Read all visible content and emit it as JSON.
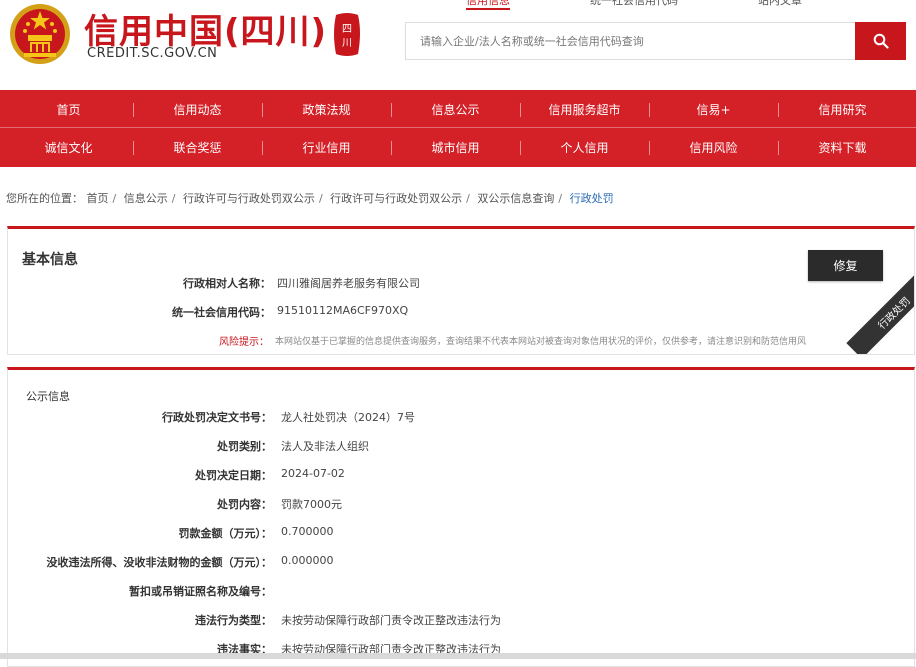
{
  "header": {
    "site_name": "信用中国(四川)",
    "site_url": "CREDIT.SC.GOV.CN",
    "seal_text": "四川",
    "top_links": [
      "信用信息",
      "统一社会信用代码",
      "站内文章"
    ],
    "search_placeholder": "请输入企业/法人名称或统一社会信用代码查询",
    "brand_color": "#c8161d"
  },
  "nav": {
    "row1": [
      "首页",
      "信用动态",
      "政策法规",
      "信息公示",
      "信用服务超市",
      "信易+",
      "信用研究"
    ],
    "row2": [
      "诚信文化",
      "联合奖惩",
      "行业信用",
      "城市信用",
      "个人信用",
      "信用风险",
      "资料下载"
    ]
  },
  "breadcrumb": {
    "prefix": "您所在的位置：",
    "items": [
      "首页",
      "信息公示",
      "行政许可与行政处罚双公示",
      "行政许可与行政处罚双公示",
      "双公示信息查询",
      "行政处罚"
    ]
  },
  "basic_info": {
    "title": "基本信息",
    "name_label": "行政相对人名称：",
    "name_value": "四川雅阁居养老服务有限公司",
    "code_label": "统一社会信用代码：",
    "code_value": "91510112MA6CF970XQ",
    "risk_label": "风险提示：",
    "risk_text": "本网站仅基于已掌握的信息提供查询服务，查询结果不代表本网站对被查询对象信用状况的评价，仅供参考，请注意识别和防范信用风",
    "repair_button": "修复",
    "ribbon": "行政处罚"
  },
  "public_info": {
    "title": "公示信息",
    "rows": [
      {
        "label": "行政处罚决定文书号：",
        "value": "龙人社处罚决（2024）7号"
      },
      {
        "label": "处罚类别：",
        "value": "法人及非法人组织"
      },
      {
        "label": "处罚决定日期：",
        "value": "2024-07-02"
      },
      {
        "label": "处罚内容：",
        "value": "罚款7000元"
      },
      {
        "label": "罚款金额（万元）：",
        "value": "0.700000"
      },
      {
        "label": "没收违法所得、没收非法财物的金额（万元）：",
        "value": "0.000000"
      },
      {
        "label": "暂扣或吊销证照名称及编号：",
        "value": ""
      },
      {
        "label": "违法行为类型：",
        "value": "未按劳动保障行政部门责令改正整改违法行为"
      },
      {
        "label": "违法事实：",
        "value": "未按劳动保障行政部门责令改正整改违法行为"
      }
    ]
  }
}
